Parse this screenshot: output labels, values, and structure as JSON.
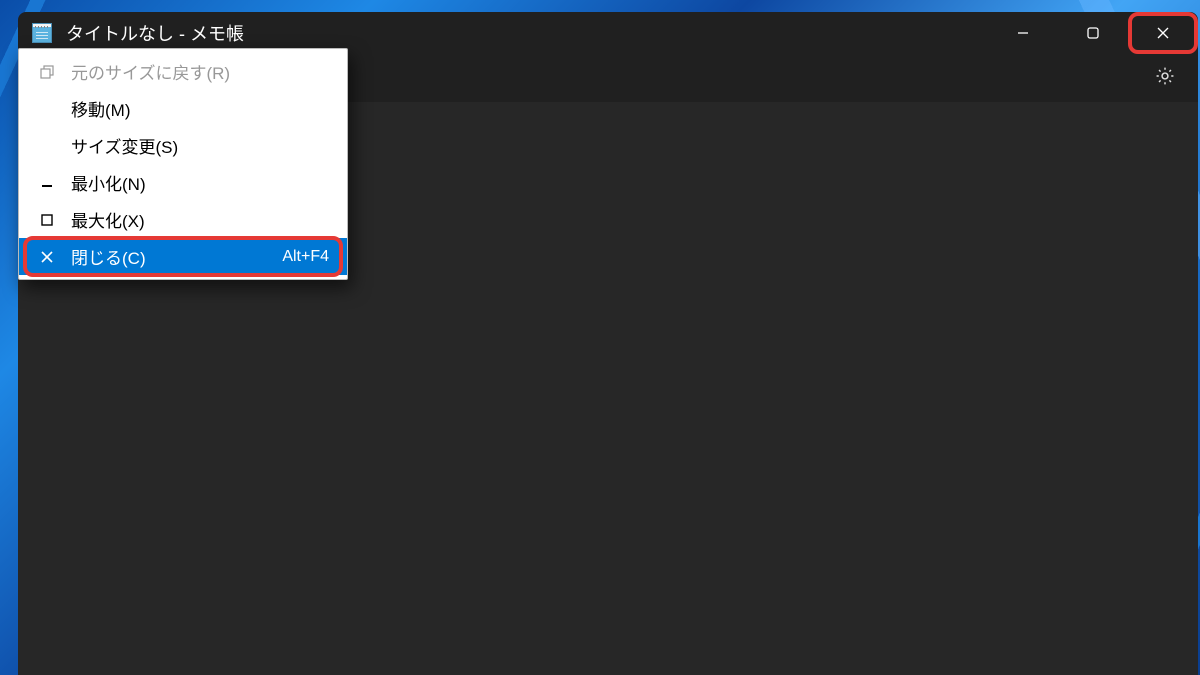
{
  "titlebar": {
    "title": "タイトルなし - メモ帳"
  },
  "system_menu": {
    "items": [
      {
        "label": "元のサイズに戻す(R)",
        "shortcut": "",
        "icon": "restore",
        "disabled": true,
        "selected": false
      },
      {
        "label": "移動(M)",
        "shortcut": "",
        "icon": "",
        "disabled": false,
        "selected": false
      },
      {
        "label": "サイズ変更(S)",
        "shortcut": "",
        "icon": "",
        "disabled": false,
        "selected": false
      },
      {
        "label": "最小化(N)",
        "shortcut": "",
        "icon": "minimize",
        "disabled": false,
        "selected": false
      },
      {
        "label": "最大化(X)",
        "shortcut": "",
        "icon": "maximize",
        "disabled": false,
        "selected": false
      },
      {
        "label": "閉じる(C)",
        "shortcut": "Alt+F4",
        "icon": "close",
        "disabled": false,
        "selected": true
      }
    ]
  }
}
